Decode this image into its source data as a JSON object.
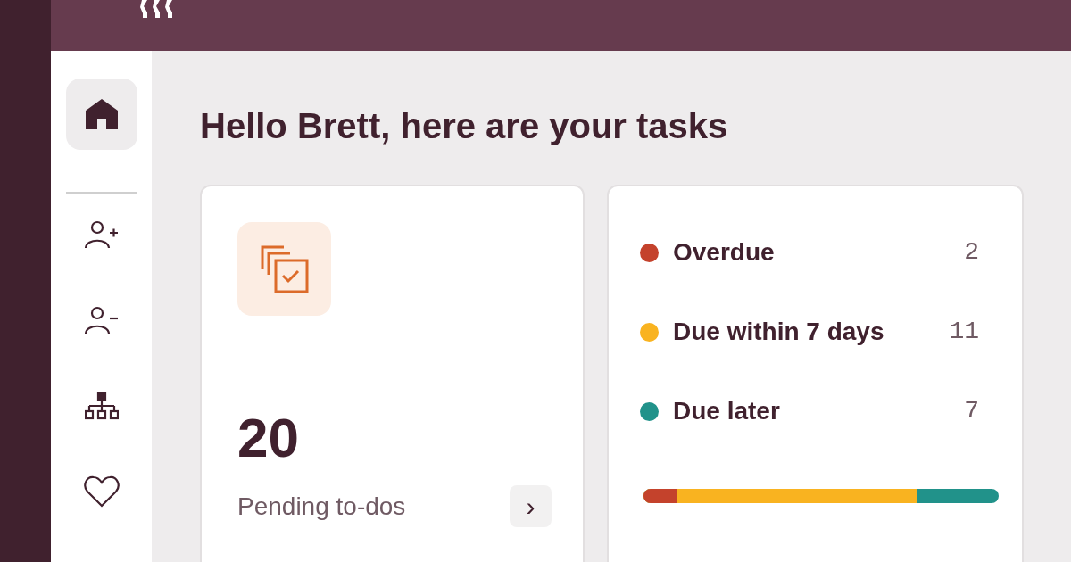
{
  "sidebar": {
    "items": [
      {
        "selected": true
      },
      {
        "selected": false
      },
      {
        "selected": false
      },
      {
        "selected": false
      },
      {
        "selected": false
      }
    ]
  },
  "greeting": "Hello Brett, here are your tasks",
  "todo_card": {
    "count": "20",
    "label": "Pending to-dos",
    "button": "›"
  },
  "categories": [
    {
      "label": "Overdue",
      "count": "2",
      "color": "#c4422c",
      "level": 0.093
    },
    {
      "label": "Due within 7 days",
      "count": "11",
      "color": "#f9b320",
      "level": 0.77
    },
    {
      "label": "Due later",
      "count": "7",
      "color": "#21928a"
    }
  ]
}
